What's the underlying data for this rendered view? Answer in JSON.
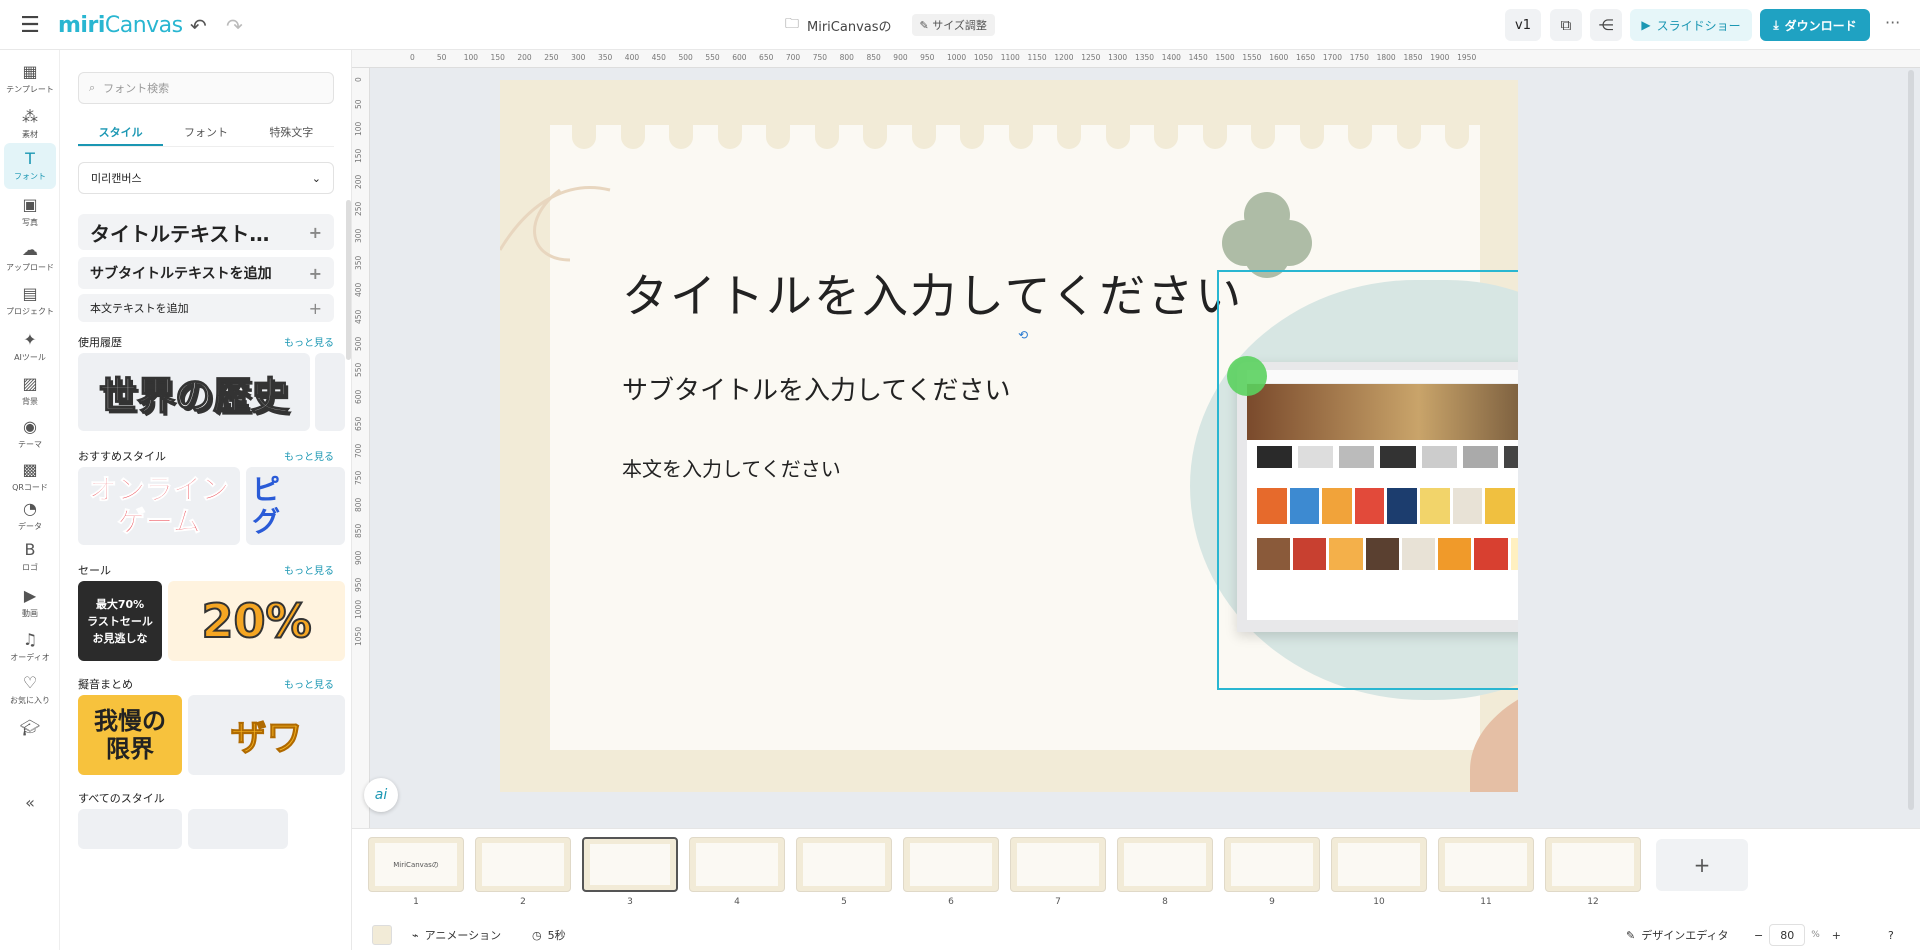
{
  "app": {
    "logo_main": "miri",
    "logo_sub": "Canvas"
  },
  "header": {
    "doc_title": "MiriCanvasの",
    "resize_label": "サイズ調整",
    "version_label": "v1",
    "slideshow_label": "スライドショー",
    "download_label": "ダウンロード"
  },
  "sidebar": {
    "items": [
      {
        "label": "テンプレート",
        "icon": "▦"
      },
      {
        "label": "素材",
        "icon": "⁂"
      },
      {
        "label": "フォント",
        "icon": "T"
      },
      {
        "label": "写真",
        "icon": "▣"
      },
      {
        "label": "アップロード",
        "icon": "☁"
      },
      {
        "label": "プロジェクト",
        "icon": "▤"
      },
      {
        "label": "AIツール",
        "icon": "✦"
      },
      {
        "label": "背景",
        "icon": "▨"
      },
      {
        "label": "テーマ",
        "icon": "◉"
      },
      {
        "label": "QRコード",
        "icon": "▩"
      },
      {
        "label": "データ",
        "icon": "◔"
      },
      {
        "label": "ロゴ",
        "icon": "B"
      },
      {
        "label": "動画",
        "icon": "▶"
      },
      {
        "label": "オーディオ",
        "icon": "♫"
      },
      {
        "label": "お気に入り",
        "icon": "♡"
      }
    ]
  },
  "panel": {
    "search_placeholder": "フォント検索",
    "tabs": [
      "スタイル",
      "フォント",
      "特殊文字"
    ],
    "font_select": "미리캔버스",
    "add_title": "タイトルテキスト…",
    "add_subtitle": "サブタイトルテキストを追加",
    "add_body": "本文テキストを追加",
    "more": "もっと見る",
    "sections": [
      {
        "title": "使用履歴",
        "tiles": [
          "世界の歴史"
        ]
      },
      {
        "title": "おすすめスタイル",
        "tiles": [
          "オンライン\nゲーム",
          "ピ\nグ"
        ]
      },
      {
        "title": "セール",
        "tiles": [
          "最大70%\nラストセール\nお見逃しな",
          "20%"
        ]
      },
      {
        "title": "擬音まとめ",
        "tiles": [
          "我慢の\n限界",
          "ザワ"
        ]
      }
    ],
    "all_styles": "すべてのスタイル"
  },
  "canvas": {
    "title": "タイトルを入力してください",
    "subtitle": "サブタイトルを入力してください",
    "body": "本文を入力してください",
    "ai_label": "ai"
  },
  "ruler": {
    "top": [
      "0",
      "50",
      "100",
      "150",
      "200",
      "250",
      "300",
      "350",
      "400",
      "450",
      "500",
      "550",
      "600",
      "650",
      "700",
      "750",
      "800",
      "850",
      "900",
      "950",
      "1000",
      "1050",
      "1100",
      "1150",
      "1200",
      "1250",
      "1300",
      "1350",
      "1400",
      "1450",
      "1500",
      "1550",
      "1600",
      "1650",
      "1700",
      "1750",
      "1800",
      "1850",
      "1900",
      "1950"
    ],
    "left": [
      "0",
      "50",
      "100",
      "150",
      "200",
      "250",
      "300",
      "350",
      "400",
      "450",
      "500",
      "550",
      "600",
      "650",
      "700",
      "750",
      "800",
      "850",
      "900",
      "950",
      "1000",
      "1050"
    ]
  },
  "thumbnails": [
    "1",
    "2",
    "3",
    "4",
    "5",
    "6",
    "7",
    "8",
    "9",
    "10",
    "11",
    "12"
  ],
  "thumb1_text": "MiriCanvasの",
  "bottom": {
    "animation": "アニメーション",
    "duration": "5秒",
    "design_editor": "デザインエディタ",
    "zoom": "80",
    "zoom_unit": "%"
  },
  "colors": {
    "accent": "#1b97b3",
    "download": "#1fa2c2",
    "slide_bg": "#f2ebd7"
  }
}
